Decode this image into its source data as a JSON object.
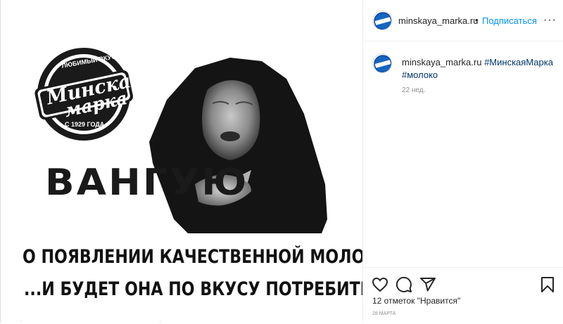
{
  "post": {
    "image_text": {
      "logo_top": "ЛЮБИМЫЙ ВКУС",
      "logo_line1": "Минская",
      "logo_line2": "марка",
      "logo_bottom": "С 1929 ГОДА",
      "headline": "ВАНГУЮ",
      "caption_line1": "О ПОЯВЛЕНИИ КАЧЕСТВЕННОЙ МОЛОЧКИ.",
      "caption_line2": "...И БУДЕТ ОНА ПО ВКУСУ ПОТРЕБИТЕЛЮ"
    }
  },
  "header": {
    "username": "minskaya_marka.ru",
    "separator": "•",
    "follow_label": "Подписаться",
    "more_label": "···"
  },
  "comment": {
    "username": "minskaya_marka.ru",
    "hashtags": [
      "#МинскаяМарка",
      "#молоко"
    ],
    "time": "22 нед."
  },
  "actions": {
    "icons": [
      "heart-icon",
      "comment-icon",
      "share-icon",
      "bookmark-icon"
    ],
    "likes_text": "12 отметок \"Нравится\"",
    "date": "28 МАРТА"
  },
  "colors": {
    "accent": "#0095f6",
    "hashtag": "#00376b",
    "text": "#262626",
    "muted": "#8e8e8e",
    "logo": "#1a1a1a"
  }
}
